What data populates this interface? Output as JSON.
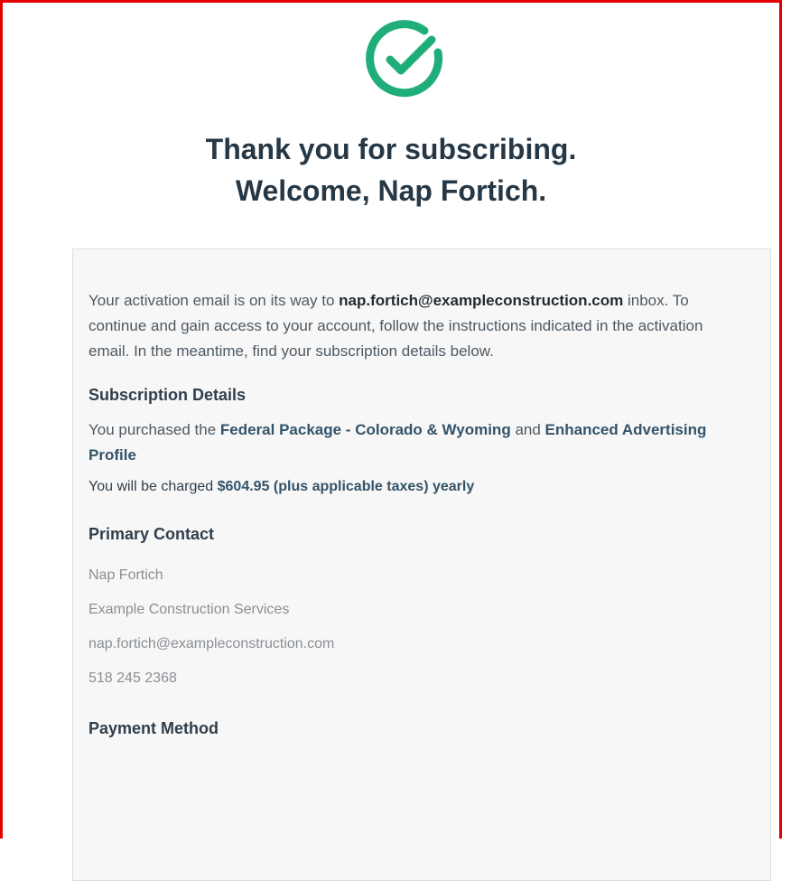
{
  "header": {
    "line1": "Thank you for subscribing.",
    "line2": "Welcome, Nap Fortich."
  },
  "intro": {
    "before": "Your activation email is on its way to ",
    "email": "nap.fortich@exampleconstruction.com",
    "after": " inbox. To continue and gain access to your account, follow the instructions indicated in the activation email. In the meantime, find your subscription details below."
  },
  "subscription": {
    "title": "Subscription Details",
    "purchased_prefix": "You purchased the ",
    "package": "Federal Package - Colorado & Wyoming",
    "and": " and ",
    "addon": "Enhanced Advertising Profile",
    "charged_prefix": "You will be charged ",
    "charged_amount": "$604.95 (plus applicable taxes) yearly"
  },
  "contact": {
    "title": "Primary Contact",
    "name": "Nap Fortich",
    "company": "Example Construction Services",
    "email": "nap.fortich@exampleconstruction.com",
    "phone": "518 245 2368"
  },
  "payment": {
    "title": "Payment Method"
  },
  "colors": {
    "success_green": "#1fae79",
    "frame_red": "#e00000"
  },
  "icons": {
    "success": "check-circle-icon"
  }
}
